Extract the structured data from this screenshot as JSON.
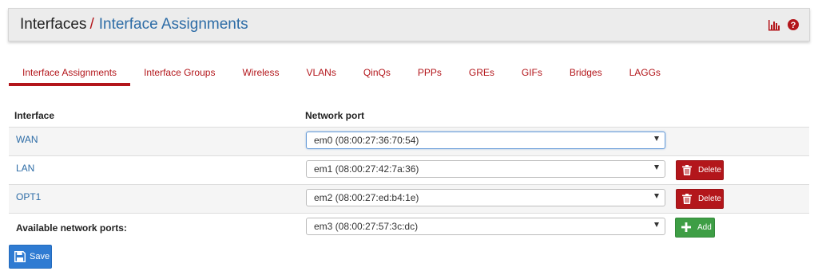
{
  "breadcrumb": {
    "root": "Interfaces",
    "separator": "/",
    "current": "Interface Assignments"
  },
  "header_icons": [
    "bar-chart-icon",
    "help-icon"
  ],
  "tabs": [
    {
      "label": "Interface Assignments",
      "active": true
    },
    {
      "label": "Interface Groups"
    },
    {
      "label": "Wireless"
    },
    {
      "label": "VLANs"
    },
    {
      "label": "QinQs"
    },
    {
      "label": "PPPs"
    },
    {
      "label": "GREs"
    },
    {
      "label": "GIFs"
    },
    {
      "label": "Bridges"
    },
    {
      "label": "LAGGs"
    }
  ],
  "table": {
    "headers": {
      "interface": "Interface",
      "network_port": "Network port"
    },
    "rows": [
      {
        "interface": "WAN",
        "port": "em0 (08:00:27:36:70:54)",
        "action": null
      },
      {
        "interface": "LAN",
        "port": "em1 (08:00:27:42:7a:36)",
        "action": "Delete"
      },
      {
        "interface": "OPT1",
        "port": "em2 (08:00:27:ed:b4:1e)",
        "action": "Delete"
      }
    ],
    "available": {
      "label": "Available network ports:",
      "port": "em3 (08:00:27:57:3c:dc)",
      "action": "Add"
    }
  },
  "save_label": "Save",
  "colors": {
    "accent_red": "#b3161b",
    "link_blue": "#2d6ca6",
    "add_green": "#3e9e45",
    "save_blue": "#2f7bd2"
  }
}
